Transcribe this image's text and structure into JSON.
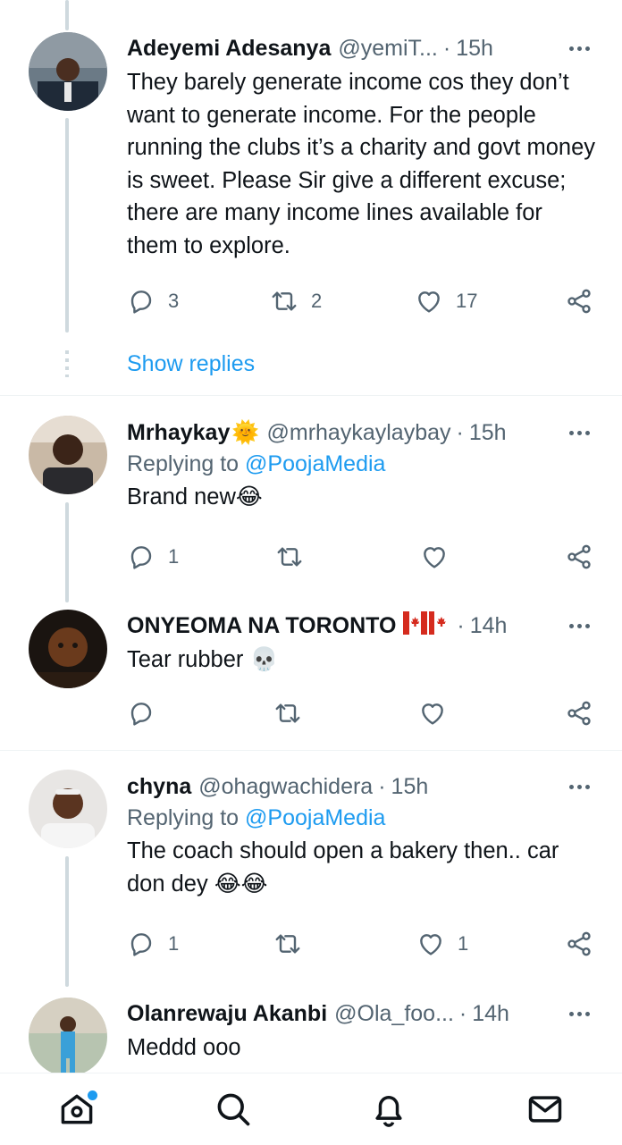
{
  "colors": {
    "accent": "#1d9bf0",
    "text_primary": "#0f1419",
    "text_secondary": "#536471",
    "thread_line": "#cfd9de"
  },
  "tweets": [
    {
      "name": "Adeyemi Adesanya",
      "badge": "",
      "handle": "@yemiT...",
      "separator": "·",
      "time": "15h",
      "replying_prefix": "",
      "replying_mention": "",
      "text": "They barely generate income cos they don’t want to generate income. For the people running the clubs it’s a charity and govt money is sweet. Please Sir give a different excuse; there are many income lines available for them to explore.",
      "replies": "3",
      "retweets": "2",
      "likes": "17",
      "show_replies": "Show replies"
    },
    {
      "name": "Mrhaykay",
      "badge": "🌞",
      "handle": "@mrhaykaylaybay",
      "separator": "·",
      "time": "15h",
      "replying_prefix": "Replying to ",
      "replying_mention": "@PoojaMedia",
      "text": "Brand new😂",
      "replies": "1",
      "retweets": "",
      "likes": ""
    },
    {
      "name": "ONYEOMA NA TORONTO",
      "badge": "🇨🇦",
      "handle": "",
      "separator": "·",
      "time": "14h",
      "replying_prefix": "",
      "replying_mention": "",
      "text": "Tear rubber 💀",
      "replies": "",
      "retweets": "",
      "likes": ""
    },
    {
      "name": "chyna",
      "badge": "",
      "handle": "@ohagwachidera",
      "separator": "·",
      "time": "15h",
      "replying_prefix": "Replying to ",
      "replying_mention": "@PoojaMedia",
      "text": "The coach should open a bakery then.. car don dey 😂😂",
      "replies": "1",
      "retweets": "",
      "likes": "1"
    },
    {
      "name": "Olanrewaju Akanbi",
      "badge": "",
      "handle": "@Ola_foo...",
      "separator": "·",
      "time": "14h",
      "replying_prefix": "",
      "replying_mention": "",
      "text": "Meddd ooo"
    }
  ],
  "tabbar": {
    "items": [
      "home-icon",
      "search-icon",
      "notifications-icon",
      "messages-icon"
    ]
  }
}
